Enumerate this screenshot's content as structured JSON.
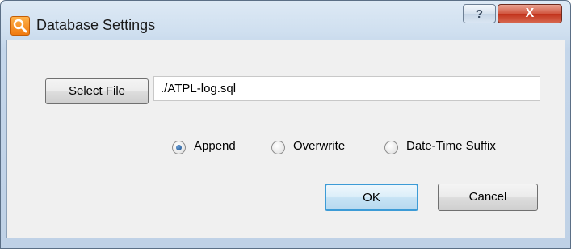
{
  "window": {
    "title": "Database Settings",
    "help_label": "?",
    "close_label": "X"
  },
  "file": {
    "button_label": "Select File",
    "path_value": "./ATPL-log.sql"
  },
  "mode": {
    "options": [
      {
        "label": "Append",
        "checked": true
      },
      {
        "label": "Overwrite",
        "checked": false
      },
      {
        "label": "Date-Time Suffix",
        "checked": false
      }
    ]
  },
  "actions": {
    "ok_label": "OK",
    "cancel_label": "Cancel"
  }
}
